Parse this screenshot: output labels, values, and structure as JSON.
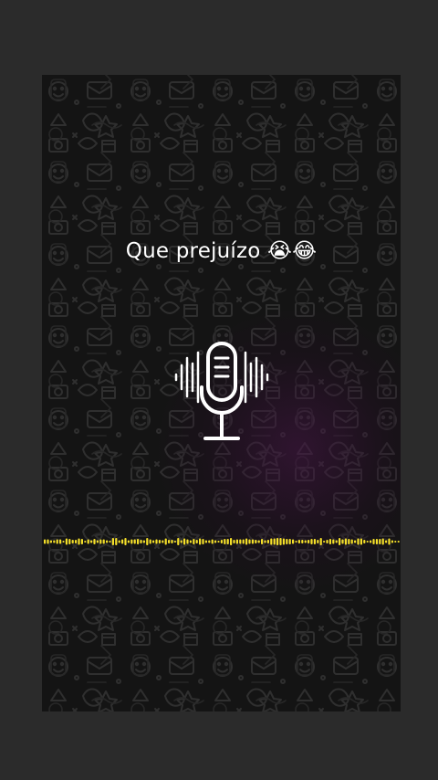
{
  "caption": {
    "text": "Que prejuízo 😭😂"
  },
  "icons": {
    "mic": "microphone-icon",
    "waveform": "audio-waveform-icon"
  },
  "colors": {
    "page_background": "#2b2b2b",
    "frame_background": "#141414",
    "doodle_stroke": "#2f2f2f",
    "caption_text": "#ffffff",
    "mic_icon": "#ffffff",
    "waveform": "#f5e02a"
  }
}
